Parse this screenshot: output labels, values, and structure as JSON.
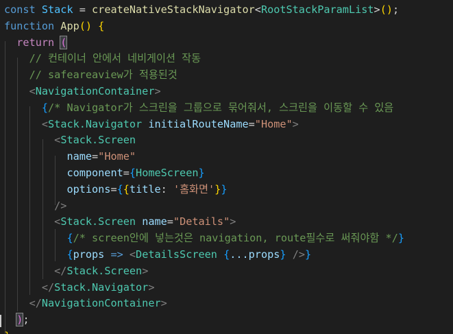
{
  "code_lines": [
    [
      {
        "t": "const ",
        "c": "t-kw"
      },
      {
        "t": "Stack",
        "c": "t-var"
      },
      {
        "t": " = ",
        "c": "t-op"
      },
      {
        "t": "createNativeStackNavigator",
        "c": "t-fn"
      },
      {
        "t": "<",
        "c": "t-op"
      },
      {
        "t": "RootStackParamList",
        "c": "t-type"
      },
      {
        "t": ">",
        "c": "t-op"
      },
      {
        "t": "()",
        "c": "t-br1"
      },
      {
        "t": ";",
        "c": "t-op"
      }
    ],
    [
      {
        "t": "function ",
        "c": "t-kw"
      },
      {
        "t": "App",
        "c": "t-fn"
      },
      {
        "t": "() ",
        "c": "t-br1"
      },
      {
        "t": "{",
        "c": "t-br1"
      }
    ],
    [
      {
        "t": "  return ",
        "c": "t-ctrl"
      },
      {
        "t": "(",
        "c": "t-br2 hl"
      }
    ],
    [
      {
        "t": "    // 컨테이너 안에서 네비게이션 작동",
        "c": "t-cmt"
      }
    ],
    [
      {
        "t": "    // safeareaview가 적용된것",
        "c": "t-cmt"
      }
    ],
    [
      {
        "t": "    ",
        "c": ""
      },
      {
        "t": "<",
        "c": "t-punc"
      },
      {
        "t": "NavigationContainer",
        "c": "t-tag"
      },
      {
        "t": ">",
        "c": "t-punc"
      }
    ],
    [
      {
        "t": "      ",
        "c": ""
      },
      {
        "t": "{",
        "c": "t-br3"
      },
      {
        "t": "/* Navigator가 스크린을 그룹으로 묶어줘서, 스크린을 이동할 수 있음",
        "c": "t-cmt"
      }
    ],
    [
      {
        "t": "      ",
        "c": ""
      },
      {
        "t": "<",
        "c": "t-punc"
      },
      {
        "t": "Stack.Navigator",
        "c": "t-tag"
      },
      {
        "t": " initialRouteName",
        "c": "t-attr"
      },
      {
        "t": "=",
        "c": "t-op"
      },
      {
        "t": "\"Home\"",
        "c": "t-str"
      },
      {
        "t": ">",
        "c": "t-punc"
      }
    ],
    [
      {
        "t": "        ",
        "c": ""
      },
      {
        "t": "<",
        "c": "t-punc"
      },
      {
        "t": "Stack.Screen",
        "c": "t-tag"
      }
    ],
    [
      {
        "t": "          ",
        "c": ""
      },
      {
        "t": "name",
        "c": "t-attr"
      },
      {
        "t": "=",
        "c": "t-op"
      },
      {
        "t": "\"Home\"",
        "c": "t-str"
      }
    ],
    [
      {
        "t": "          ",
        "c": ""
      },
      {
        "t": "component",
        "c": "t-attr"
      },
      {
        "t": "=",
        "c": "t-op"
      },
      {
        "t": "{",
        "c": "t-br3"
      },
      {
        "t": "HomeScreen",
        "c": "t-tag"
      },
      {
        "t": "}",
        "c": "t-br3"
      }
    ],
    [
      {
        "t": "          ",
        "c": ""
      },
      {
        "t": "options",
        "c": "t-attr"
      },
      {
        "t": "=",
        "c": "t-op"
      },
      {
        "t": "{",
        "c": "t-br3"
      },
      {
        "t": "{",
        "c": "t-br1"
      },
      {
        "t": "title",
        "c": "t-attr"
      },
      {
        "t": ": ",
        "c": "t-op"
      },
      {
        "t": "'홈화면'",
        "c": "t-str"
      },
      {
        "t": "}",
        "c": "t-br1"
      },
      {
        "t": "}",
        "c": "t-br3"
      }
    ],
    [
      {
        "t": "        ",
        "c": ""
      },
      {
        "t": "/>",
        "c": "t-punc"
      }
    ],
    [
      {
        "t": "        ",
        "c": ""
      },
      {
        "t": "<",
        "c": "t-punc"
      },
      {
        "t": "Stack.Screen",
        "c": "t-tag"
      },
      {
        "t": " name",
        "c": "t-attr"
      },
      {
        "t": "=",
        "c": "t-op"
      },
      {
        "t": "\"Details\"",
        "c": "t-str"
      },
      {
        "t": ">",
        "c": "t-punc"
      }
    ],
    [
      {
        "t": "          ",
        "c": ""
      },
      {
        "t": "{",
        "c": "t-br3"
      },
      {
        "t": "/* screen안에 넣는것은 navigation, route필수로 써줘야함 */",
        "c": "t-cmt"
      },
      {
        "t": "}",
        "c": "t-br3"
      }
    ],
    [
      {
        "t": "          ",
        "c": ""
      },
      {
        "t": "{",
        "c": "t-br3"
      },
      {
        "t": "props",
        "c": "t-attr"
      },
      {
        "t": " => ",
        "c": "t-kw"
      },
      {
        "t": "<",
        "c": "t-punc"
      },
      {
        "t": "DetailsScreen",
        "c": "t-tag"
      },
      {
        "t": " ",
        "c": ""
      },
      {
        "t": "{",
        "c": "t-br3"
      },
      {
        "t": "...props",
        "c": "t-attr"
      },
      {
        "t": "}",
        "c": "t-br3"
      },
      {
        "t": " />",
        "c": "t-punc"
      },
      {
        "t": "}",
        "c": "t-br3"
      }
    ],
    [
      {
        "t": "        ",
        "c": ""
      },
      {
        "t": "</",
        "c": "t-punc"
      },
      {
        "t": "Stack.Screen",
        "c": "t-tag"
      },
      {
        "t": ">",
        "c": "t-punc"
      }
    ],
    [
      {
        "t": "      ",
        "c": ""
      },
      {
        "t": "</",
        "c": "t-punc"
      },
      {
        "t": "Stack.Navigator",
        "c": "t-tag"
      },
      {
        "t": ">",
        "c": "t-punc"
      }
    ],
    [
      {
        "t": "    ",
        "c": ""
      },
      {
        "t": "</",
        "c": "t-punc"
      },
      {
        "t": "NavigationContainer",
        "c": "t-tag"
      },
      {
        "t": ">",
        "c": "t-punc"
      }
    ],
    [
      {
        "t": "  ",
        "c": ""
      },
      {
        "t": ")",
        "c": "t-br2 hl"
      },
      {
        "t": ";",
        "c": "t-op"
      }
    ],
    [
      {
        "t": "}",
        "c": "t-br1"
      }
    ]
  ]
}
